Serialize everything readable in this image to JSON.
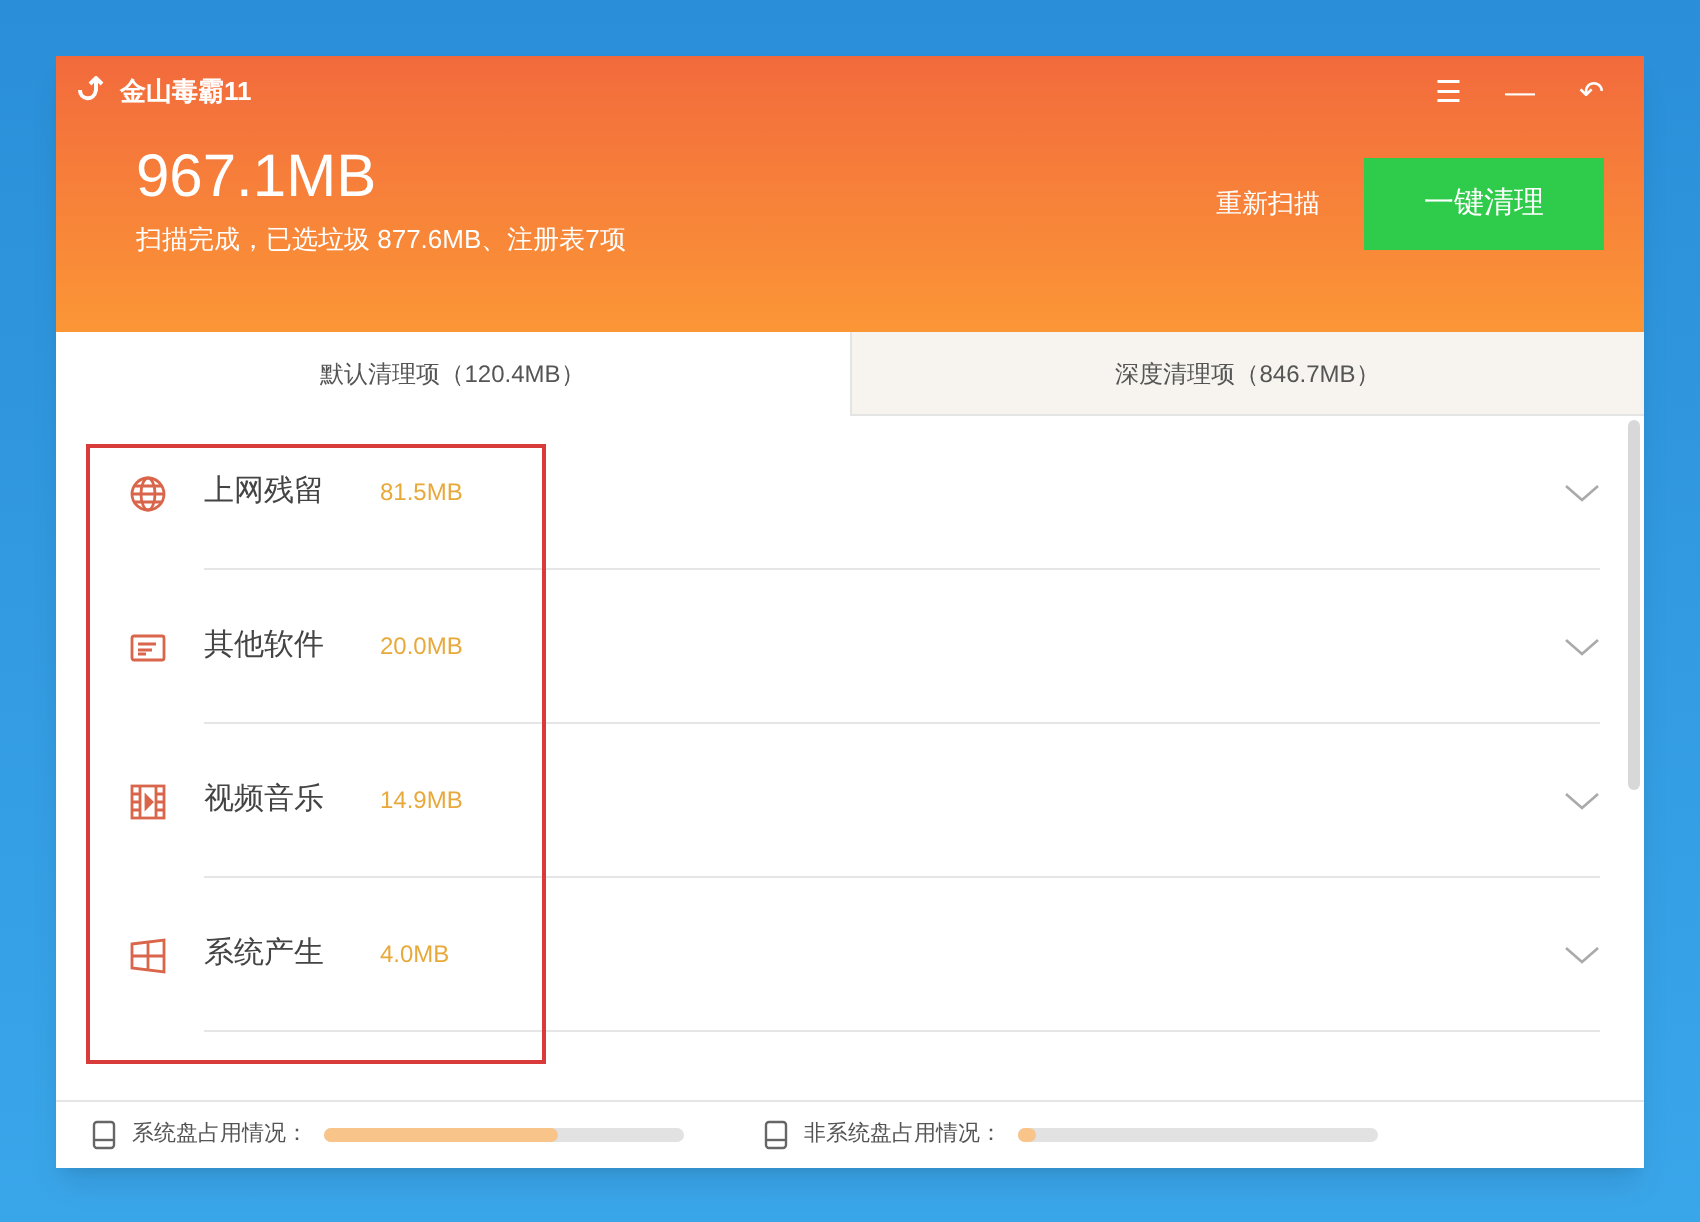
{
  "window": {
    "title": "金山毒霸11",
    "controls": [
      "☰",
      "—",
      "↶"
    ]
  },
  "summary": {
    "size": "967.1MB",
    "detail": "扫描完成，已选垃圾 877.6MB、注册表7项",
    "rescan": "重新扫描",
    "clean": "一键清理"
  },
  "tabs": [
    {
      "label": "默认清理项（120.4MB）",
      "selected": true
    },
    {
      "label": "深度清理项（846.7MB）",
      "selected": false
    }
  ],
  "items": [
    {
      "kind": "globe",
      "name": "上网残留",
      "size": "81.5MB"
    },
    {
      "kind": "document",
      "name": "其他软件",
      "size": "20.0MB"
    },
    {
      "kind": "film",
      "name": "视频音乐",
      "size": "14.9MB"
    },
    {
      "kind": "windows",
      "name": "系统产生",
      "size": "4.0MB"
    }
  ],
  "status_bar": [
    {
      "label": "系统盘占用情况：",
      "level": 0.65
    },
    {
      "label": "非系统盘占用情况：",
      "level": 0.05
    }
  ]
}
